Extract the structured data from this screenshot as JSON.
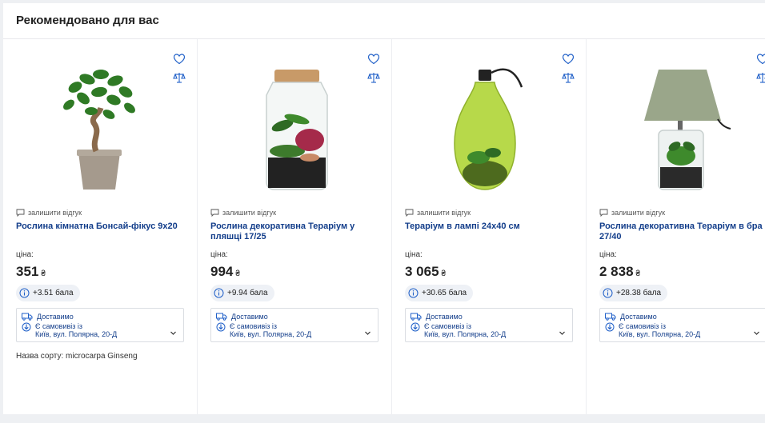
{
  "section": {
    "title": "Рекомендовано для вас"
  },
  "products": [
    {
      "review_label": "залишити відгук",
      "name": "Рослина кімнатна Бонсай-фікус 9x20",
      "price_label": "ціна:",
      "price": "351",
      "currency": "₴",
      "bonus": "+3.51 бала",
      "delivery_label": "Доставимо",
      "pickup_label": "Є самовивіз із",
      "pickup_address": "Київ, вул. Полярна, 20-Д",
      "variety": "Назва сорту: microcarpa Ginseng",
      "image": "bonsai-ficus"
    },
    {
      "review_label": "залишити відгук",
      "name": "Рослина декоративна Тераріум у пляшці 17/25",
      "price_label": "ціна:",
      "price": "994",
      "currency": "₴",
      "bonus": "+9.94 бала",
      "delivery_label": "Доставимо",
      "pickup_label": "Є самовивіз із",
      "pickup_address": "Київ, вул. Полярна, 20-Д",
      "variety": "",
      "image": "terrarium-jar"
    },
    {
      "review_label": "залишити відгук",
      "name": "Тераріум в лампі 24x40 см",
      "price_label": "ціна:",
      "price": "3 065",
      "currency": "₴",
      "bonus": "+30.65 бала",
      "delivery_label": "Доставимо",
      "pickup_label": "Є самовивіз із",
      "pickup_address": "Київ, вул. Полярна, 20-Д",
      "variety": "",
      "image": "terrarium-bulb"
    },
    {
      "review_label": "залишити відгук",
      "name": "Рослина декоративна Тераріум в бра 27/40",
      "price_label": "ціна:",
      "price": "2 838",
      "currency": "₴",
      "bonus": "+28.38 бала",
      "delivery_label": "Доставимо",
      "pickup_label": "Є самовивіз із",
      "pickup_address": "Київ, вул. Полярна, 20-Д",
      "variety": "",
      "image": "terrarium-lamp"
    }
  ],
  "colors": {
    "link": "#123d8a",
    "accent": "#1f5fc8",
    "bonus_bg": "#eef1f6"
  }
}
